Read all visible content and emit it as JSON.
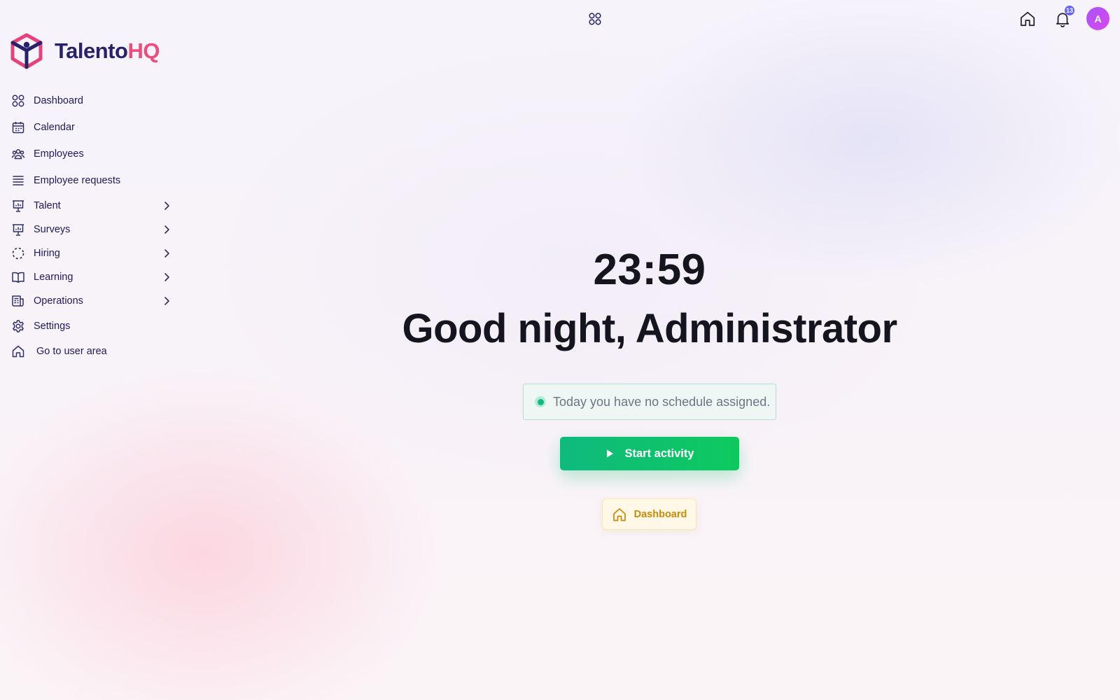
{
  "brand": {
    "name_part1": "Talento",
    "name_part2": "HQ",
    "colors": {
      "primary": "#28226b",
      "accent": "#ec4d7c"
    }
  },
  "topbar": {
    "apps_icon": "apps-grid-icon",
    "home_icon": "home-icon",
    "notifications_icon": "bell-icon",
    "notification_count": "13",
    "avatar_initial": "A"
  },
  "sidebar": {
    "items": [
      {
        "label": "Dashboard",
        "icon": "dashboard-grid-icon",
        "has_submenu": false
      },
      {
        "label": "Calendar",
        "icon": "calendar-icon",
        "has_submenu": false
      },
      {
        "label": "Employees",
        "icon": "users-icon",
        "has_submenu": false
      },
      {
        "label": "Employee requests",
        "icon": "list-icon",
        "has_submenu": false
      },
      {
        "label": "Talent",
        "icon": "presentation-chart-icon",
        "has_submenu": true
      },
      {
        "label": "Surveys",
        "icon": "presentation-chart-icon",
        "has_submenu": true
      },
      {
        "label": "Hiring",
        "icon": "dashed-circle-icon",
        "has_submenu": true
      },
      {
        "label": "Learning",
        "icon": "book-open-icon",
        "has_submenu": true
      },
      {
        "label": "Operations",
        "icon": "document-grid-icon",
        "has_submenu": true
      },
      {
        "label": "Settings",
        "icon": "gear-icon",
        "has_submenu": false
      },
      {
        "label": "Go to user area",
        "icon": "home-icon",
        "has_submenu": false
      }
    ]
  },
  "main": {
    "time": "23:59",
    "greeting": "Good night, Administrator",
    "schedule_status": "Today you have no schedule assigned.",
    "start_button": "Start activity",
    "dashboard_button": "Dashboard",
    "colors": {
      "success": "#12b981",
      "start_button": "#0ec95e",
      "dashboard_text": "#c78a0b"
    }
  }
}
